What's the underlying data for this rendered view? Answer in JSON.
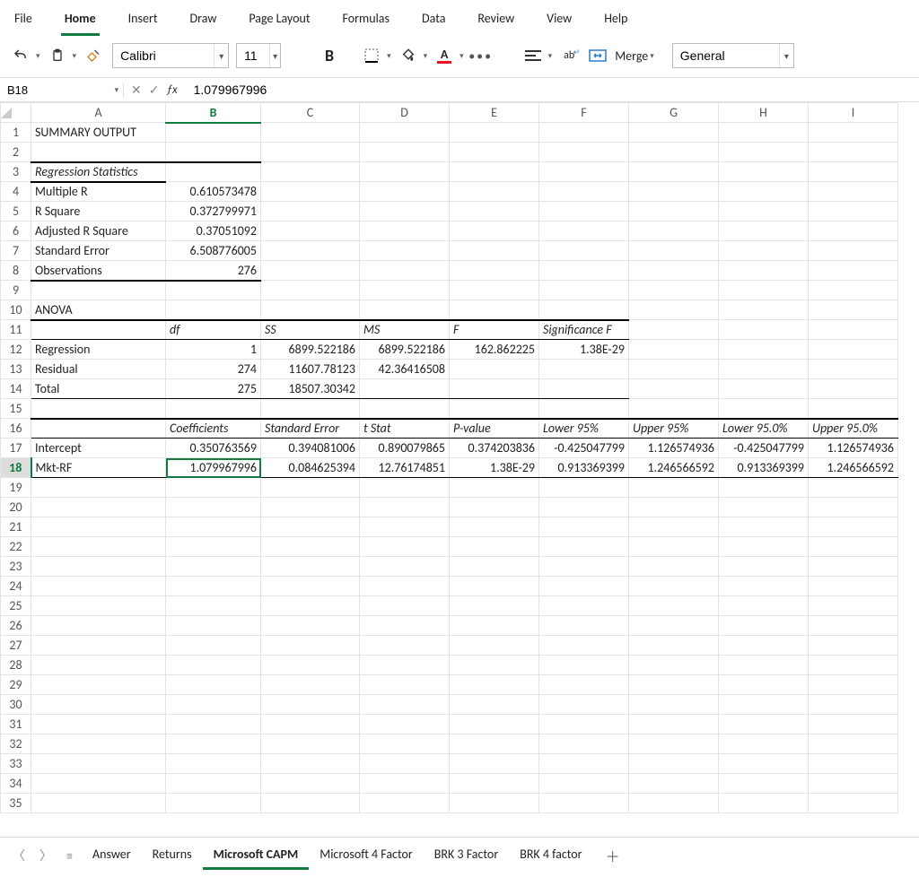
{
  "ribbon": {
    "tabs": [
      "File",
      "Home",
      "Insert",
      "Draw",
      "Page Layout",
      "Formulas",
      "Data",
      "Review",
      "View",
      "Help"
    ],
    "activeIndex": 1
  },
  "toolbar": {
    "fontName": "Calibri",
    "fontSize": "11",
    "boldLabel": "B",
    "mergeLabel": "Merge",
    "numberFormat": "General"
  },
  "nameBox": "B18",
  "formula": "1.079967996",
  "columns": [
    "A",
    "B",
    "C",
    "D",
    "E",
    "F",
    "G",
    "H",
    "I"
  ],
  "selectedCol": "B",
  "selectedRow": 18,
  "rows": 35,
  "cells": {
    "A1": "SUMMARY OUTPUT",
    "A3": "Regression Statistics",
    "A4": "Multiple R",
    "B4": "0.610573478",
    "A5": "R Square",
    "B5": "0.372799971",
    "A6": "Adjusted R Square",
    "B6": "0.37051092",
    "A7": "Standard Error",
    "B7": "6.508776005",
    "A8": "Observations",
    "B8": "276",
    "A10": "ANOVA",
    "B11": "df",
    "C11": "SS",
    "D11": "MS",
    "E11": "F",
    "F11": "Significance F",
    "A12": "Regression",
    "B12": "1",
    "C12": "6899.522186",
    "D12": "6899.522186",
    "E12": "162.862225",
    "F12": "1.38E-29",
    "A13": "Residual",
    "B13": "274",
    "C13": "11607.78123",
    "D13": "42.36416508",
    "A14": "Total",
    "B14": "275",
    "C14": "18507.30342",
    "B16": "Coefficients",
    "C16": "Standard Error",
    "D16": "t Stat",
    "E16": "P-value",
    "F16": "Lower 95%",
    "G16": "Upper 95%",
    "H16": "Lower 95.0%",
    "I16": "Upper 95.0%",
    "A17": "Intercept",
    "B17": "0.350763569",
    "C17": "0.394081006",
    "D17": "0.890079865",
    "E17": "0.374203836",
    "F17": "-0.425047799",
    "G17": "1.126574936",
    "H17": "-0.425047799",
    "I17": "1.126574936",
    "A18": "Mkt-RF",
    "B18": "1.079967996",
    "C18": "0.084625394",
    "D18": "12.76174851",
    "E18": "1.38E-29",
    "F18": "0.913369399",
    "G18": "1.246566592",
    "H18": "0.913369399",
    "I18": "1.246566592"
  },
  "cellMeta": {
    "rightAlign": [
      "B4",
      "B5",
      "B6",
      "B7",
      "B8",
      "B12",
      "C12",
      "D12",
      "E12",
      "F12",
      "B13",
      "C13",
      "D13",
      "B14",
      "C14",
      "B17",
      "C17",
      "D17",
      "E17",
      "F17",
      "G17",
      "H17",
      "I17",
      "B18",
      "C18",
      "D18",
      "E18",
      "F18",
      "G18",
      "H18",
      "I18"
    ],
    "italic": [
      "A3",
      "B11",
      "C11",
      "D11",
      "E11",
      "F11",
      "B16",
      "C16",
      "D16",
      "E16",
      "F16",
      "G16",
      "H16",
      "I16"
    ]
  },
  "borders": {
    "bb": {
      "3": [
        "A"
      ],
      "8": [
        "A",
        "B"
      ]
    },
    "bt": {
      "3": [
        "A",
        "B"
      ],
      "11": [
        "A",
        "B",
        "C",
        "D",
        "E",
        "F"
      ],
      "16": [
        "A",
        "B",
        "C",
        "D",
        "E",
        "F",
        "G",
        "H",
        "I"
      ]
    },
    "bb1": {
      "11": [
        "A",
        "B",
        "C",
        "D",
        "E",
        "F"
      ],
      "14": [
        "A",
        "B",
        "C",
        "D",
        "E",
        "F"
      ],
      "16": [
        "A",
        "B",
        "C",
        "D",
        "E",
        "F",
        "G",
        "H",
        "I"
      ],
      "18": [
        "A",
        "B",
        "C",
        "D",
        "E",
        "F",
        "G",
        "H",
        "I"
      ]
    }
  },
  "sheets": {
    "tabs": [
      "Answer",
      "Returns",
      "Microsoft CAPM",
      "Microsoft 4 Factor",
      "BRK 3 Factor",
      "BRK 4 factor"
    ],
    "activeIndex": 2
  }
}
